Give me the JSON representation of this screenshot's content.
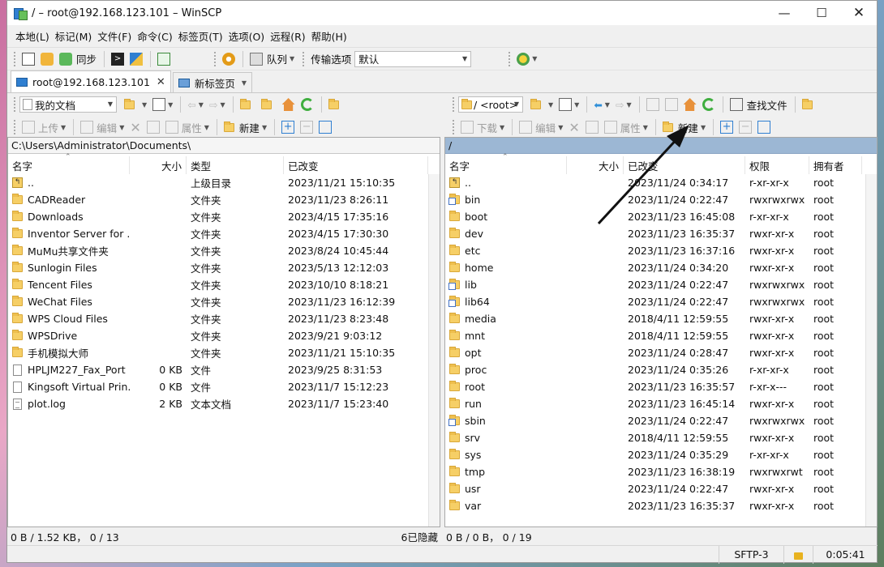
{
  "window": {
    "title": "/ – root@192.168.123.101 – WinSCP"
  },
  "menu": [
    "本地(L)",
    "标记(M)",
    "文件(F)",
    "命令(C)",
    "标签页(T)",
    "选项(O)",
    "远程(R)",
    "帮助(H)"
  ],
  "toolbar": {
    "sync_label": "同步",
    "queue_label": "队列",
    "transfer_label": "传输选项",
    "transfer_value": "默认"
  },
  "tabs": [
    {
      "label": "root@192.168.123.101"
    },
    {
      "label": "新标签页"
    }
  ],
  "left": {
    "location": "我的文档",
    "actions": {
      "upload": "上传",
      "edit": "编辑",
      "props": "属性",
      "new": "新建"
    },
    "path": "C:\\Users\\Administrator\\Documents\\",
    "columns": [
      "名字",
      "大小",
      "类型",
      "已改变"
    ],
    "rows": [
      {
        "icon": "parent",
        "name": "..",
        "size": "",
        "type": "上级目录",
        "date": "2023/11/21 15:10:35"
      },
      {
        "icon": "folder",
        "name": "CADReader",
        "size": "",
        "type": "文件夹",
        "date": "2023/11/23 8:26:11"
      },
      {
        "icon": "folder",
        "name": "Downloads",
        "size": "",
        "type": "文件夹",
        "date": "2023/4/15 17:35:16"
      },
      {
        "icon": "folder",
        "name": "Inventor Server for ...",
        "size": "",
        "type": "文件夹",
        "date": "2023/4/15 17:30:30"
      },
      {
        "icon": "folder",
        "name": "MuMu共享文件夹",
        "size": "",
        "type": "文件夹",
        "date": "2023/8/24 10:45:44"
      },
      {
        "icon": "folder",
        "name": "Sunlogin Files",
        "size": "",
        "type": "文件夹",
        "date": "2023/5/13 12:12:03"
      },
      {
        "icon": "folder",
        "name": "Tencent Files",
        "size": "",
        "type": "文件夹",
        "date": "2023/10/10 8:18:21"
      },
      {
        "icon": "folder",
        "name": "WeChat Files",
        "size": "",
        "type": "文件夹",
        "date": "2023/11/23 16:12:39"
      },
      {
        "icon": "folder",
        "name": "WPS Cloud Files",
        "size": "",
        "type": "文件夹",
        "date": "2023/11/23 8:23:48"
      },
      {
        "icon": "folder",
        "name": "WPSDrive",
        "size": "",
        "type": "文件夹",
        "date": "2023/9/21 9:03:12"
      },
      {
        "icon": "folder",
        "name": "手机模拟大师",
        "size": "",
        "type": "文件夹",
        "date": "2023/11/21 15:10:35"
      },
      {
        "icon": "file",
        "name": "HPLJM227_Fax_Port",
        "size": "0 KB",
        "type": "文件",
        "date": "2023/9/25 8:31:53"
      },
      {
        "icon": "file",
        "name": "Kingsoft Virtual Prin...",
        "size": "0 KB",
        "type": "文件",
        "date": "2023/11/7 15:12:23"
      },
      {
        "icon": "textfile",
        "name": "plot.log",
        "size": "2 KB",
        "type": "文本文档",
        "date": "2023/11/7 15:23:40"
      }
    ],
    "status": "0 B / 1.52 KB，  0 / 13",
    "hidden": "6已隐藏"
  },
  "right": {
    "location": "/ <root>",
    "find_label": "查找文件",
    "actions": {
      "download": "下载",
      "edit": "编辑",
      "props": "属性",
      "new": "新建"
    },
    "path": "/",
    "columns": [
      "名字",
      "大小",
      "已改变",
      "权限",
      "拥有者"
    ],
    "rows": [
      {
        "icon": "parent",
        "name": "..",
        "date": "2023/11/24 0:34:17",
        "perm": "r-xr-xr-x",
        "owner": "root"
      },
      {
        "icon": "link",
        "name": "bin",
        "date": "2023/11/24 0:22:47",
        "perm": "rwxrwxrwx",
        "owner": "root"
      },
      {
        "icon": "folder",
        "name": "boot",
        "date": "2023/11/23 16:45:08",
        "perm": "r-xr-xr-x",
        "owner": "root"
      },
      {
        "icon": "folder",
        "name": "dev",
        "date": "2023/11/23 16:35:37",
        "perm": "rwxr-xr-x",
        "owner": "root"
      },
      {
        "icon": "folder",
        "name": "etc",
        "date": "2023/11/23 16:37:16",
        "perm": "rwxr-xr-x",
        "owner": "root"
      },
      {
        "icon": "folder",
        "name": "home",
        "date": "2023/11/24 0:34:20",
        "perm": "rwxr-xr-x",
        "owner": "root"
      },
      {
        "icon": "link",
        "name": "lib",
        "date": "2023/11/24 0:22:47",
        "perm": "rwxrwxrwx",
        "owner": "root"
      },
      {
        "icon": "link",
        "name": "lib64",
        "date": "2023/11/24 0:22:47",
        "perm": "rwxrwxrwx",
        "owner": "root"
      },
      {
        "icon": "folder",
        "name": "media",
        "date": "2018/4/11 12:59:55",
        "perm": "rwxr-xr-x",
        "owner": "root"
      },
      {
        "icon": "folder",
        "name": "mnt",
        "date": "2018/4/11 12:59:55",
        "perm": "rwxr-xr-x",
        "owner": "root"
      },
      {
        "icon": "folder",
        "name": "opt",
        "date": "2023/11/24 0:28:47",
        "perm": "rwxr-xr-x",
        "owner": "root"
      },
      {
        "icon": "folder",
        "name": "proc",
        "date": "2023/11/24 0:35:26",
        "perm": "r-xr-xr-x",
        "owner": "root"
      },
      {
        "icon": "folder",
        "name": "root",
        "date": "2023/11/23 16:35:57",
        "perm": "r-xr-x---",
        "owner": "root"
      },
      {
        "icon": "folder",
        "name": "run",
        "date": "2023/11/23 16:45:14",
        "perm": "rwxr-xr-x",
        "owner": "root"
      },
      {
        "icon": "link",
        "name": "sbin",
        "date": "2023/11/24 0:22:47",
        "perm": "rwxrwxrwx",
        "owner": "root"
      },
      {
        "icon": "folder",
        "name": "srv",
        "date": "2018/4/11 12:59:55",
        "perm": "rwxr-xr-x",
        "owner": "root"
      },
      {
        "icon": "folder",
        "name": "sys",
        "date": "2023/11/24 0:35:29",
        "perm": "r-xr-xr-x",
        "owner": "root"
      },
      {
        "icon": "folder",
        "name": "tmp",
        "date": "2023/11/23 16:38:19",
        "perm": "rwxrwxrwt",
        "owner": "root"
      },
      {
        "icon": "folder",
        "name": "usr",
        "date": "2023/11/24 0:22:47",
        "perm": "rwxr-xr-x",
        "owner": "root"
      },
      {
        "icon": "folder",
        "name": "var",
        "date": "2023/11/23 16:35:37",
        "perm": "rwxr-xr-x",
        "owner": "root"
      }
    ],
    "status": "0 B / 0 B，  0 / 19",
    "protocol": "SFTP-3",
    "timer": "0:05:41"
  }
}
